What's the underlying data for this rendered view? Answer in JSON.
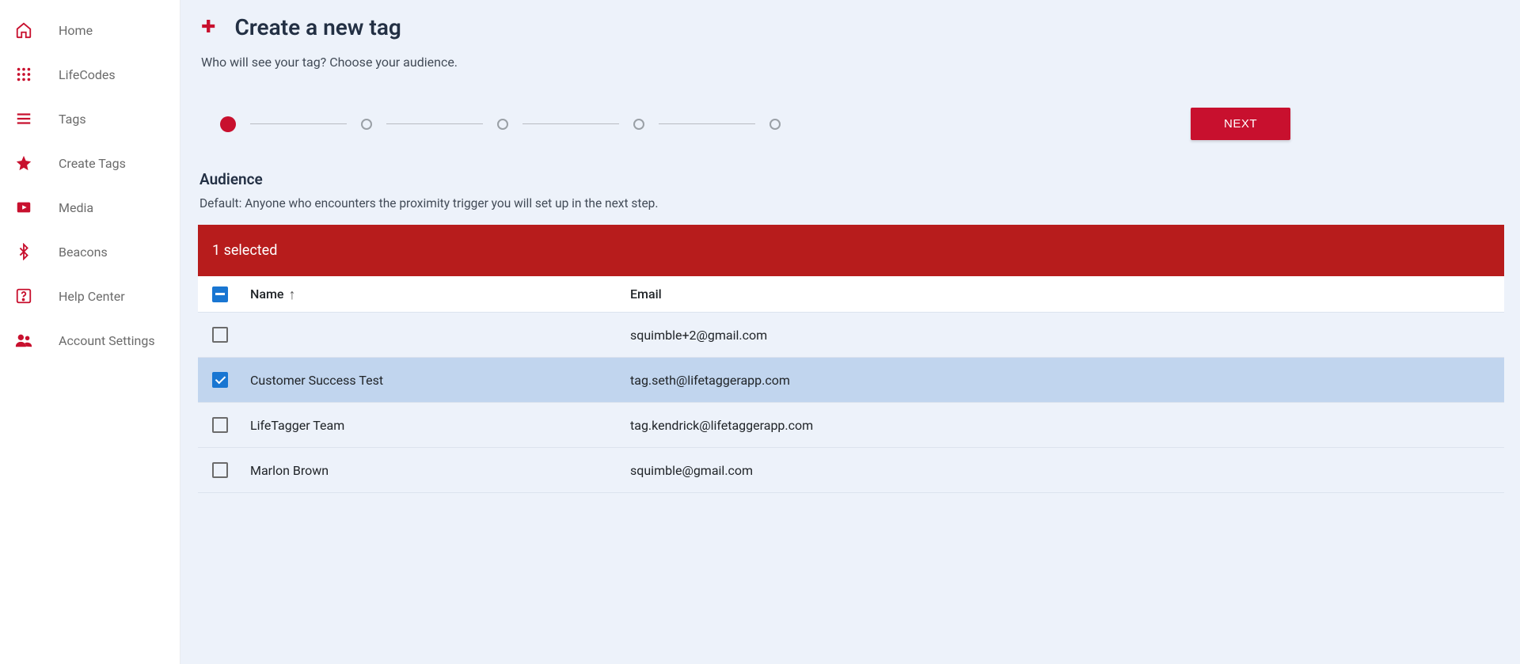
{
  "sidebar": {
    "items": [
      {
        "label": "Home",
        "icon": "home-icon"
      },
      {
        "label": "LifeCodes",
        "icon": "apps-icon"
      },
      {
        "label": "Tags",
        "icon": "list-icon"
      },
      {
        "label": "Create Tags",
        "icon": "star-icon"
      },
      {
        "label": "Media",
        "icon": "media-icon"
      },
      {
        "label": "Beacons",
        "icon": "bluetooth-icon"
      },
      {
        "label": "Help Center",
        "icon": "help-icon"
      },
      {
        "label": "Account Settings",
        "icon": "people-icon"
      }
    ]
  },
  "page": {
    "title": "Create a new tag",
    "subtitle": "Who will see your tag? Choose your audience.",
    "next_label": "NEXT",
    "stepper": {
      "total": 5,
      "current": 1
    }
  },
  "audience": {
    "section_title": "Audience",
    "section_desc": "Default: Anyone who encounters the proximity trigger you will set up in the next step.",
    "selected_text": "1 selected",
    "columns": {
      "name": "Name",
      "email": "Email"
    },
    "sort": {
      "column": "name",
      "direction": "asc"
    },
    "rows": [
      {
        "name": "",
        "email": "squimble+2@gmail.com",
        "selected": false
      },
      {
        "name": "Customer Success Test",
        "email": "tag.seth@lifetaggerapp.com",
        "selected": true
      },
      {
        "name": "LifeTagger Team",
        "email": "tag.kendrick@lifetaggerapp.com",
        "selected": false
      },
      {
        "name": "Marlon Brown",
        "email": "squimble@gmail.com",
        "selected": false
      }
    ]
  },
  "colors": {
    "accent": "#c8102e",
    "selected_bar": "#b71c1c",
    "selected_row": "#c1d5ee"
  }
}
